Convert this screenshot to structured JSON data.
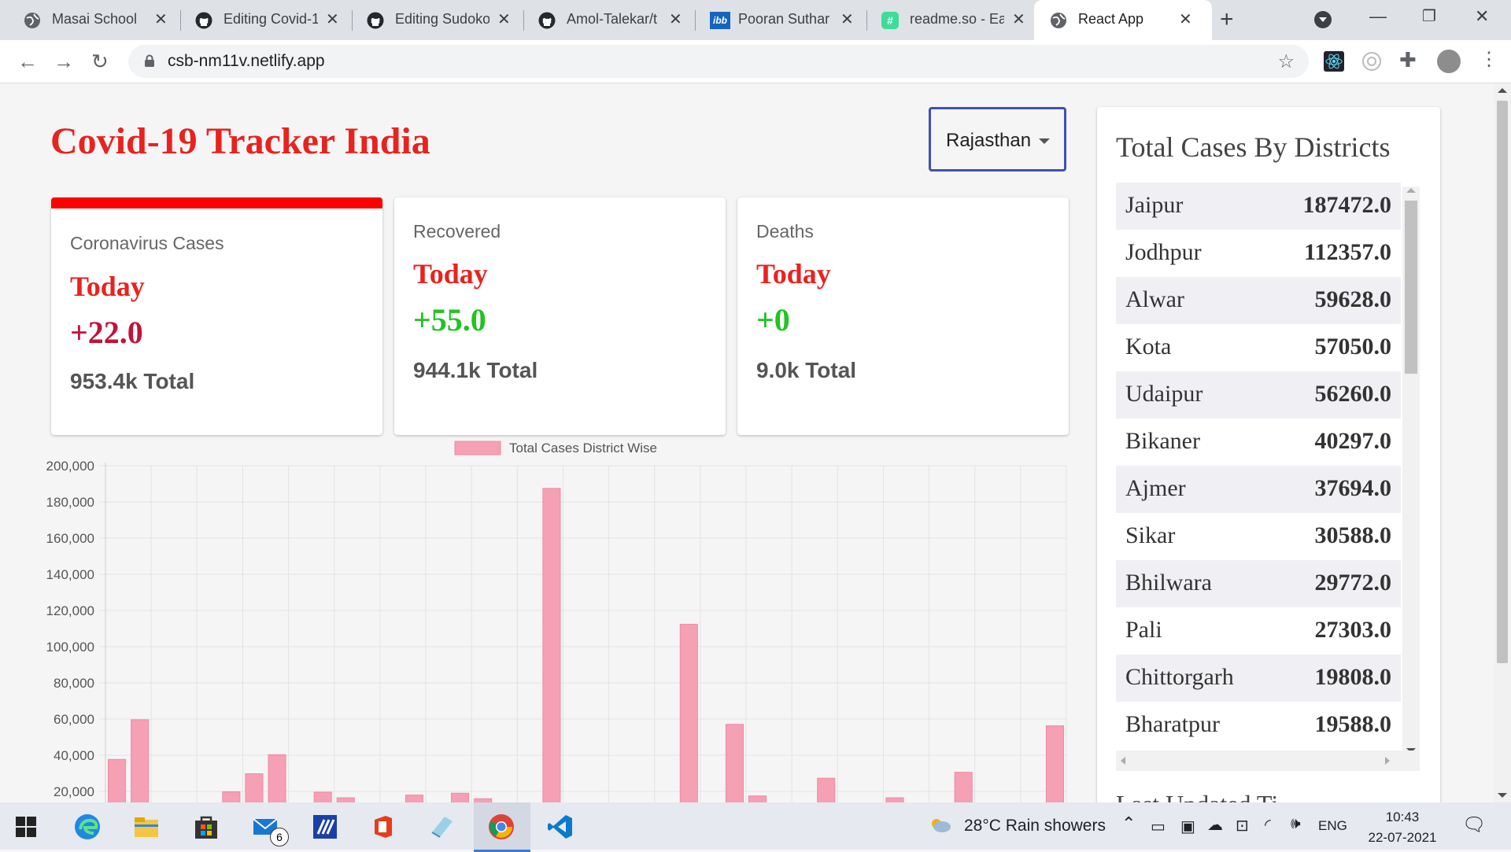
{
  "browser": {
    "tabs": [
      {
        "label": "Masai School",
        "icon": "globe-icon"
      },
      {
        "label": "Editing Covid-1",
        "icon": "github-icon"
      },
      {
        "label": "Editing Sudoko",
        "icon": "github-icon"
      },
      {
        "label": "Amol-Talekar/t",
        "icon": "github-icon"
      },
      {
        "label": "Pooran Suthar",
        "icon": "ibb-icon"
      },
      {
        "label": "readme.so - Ea",
        "icon": "readme-icon"
      },
      {
        "label": "React App",
        "icon": "globe-icon"
      }
    ],
    "url": "csb-nm11v.netlify.app"
  },
  "page": {
    "title": "Covid-19 Tracker India",
    "state_select": "Rajasthan",
    "cards": [
      {
        "title": "Coronavirus Cases",
        "today": "Today",
        "value": "+22.0",
        "total": "953.4k Total",
        "accent": "#c0143c"
      },
      {
        "title": "Recovered",
        "today": "Today",
        "value": "+55.0",
        "total": "944.1k Total",
        "accent": "#22c322"
      },
      {
        "title": "Deaths",
        "today": "Today",
        "value": "+0",
        "total": "9.0k Total",
        "accent": "#22c322"
      }
    ],
    "sidebar": {
      "title": "Total Cases By Districts",
      "districts": [
        {
          "name": "Jaipur",
          "value": "187472.0"
        },
        {
          "name": "Jodhpur",
          "value": "112357.0"
        },
        {
          "name": "Alwar",
          "value": "59628.0"
        },
        {
          "name": "Kota",
          "value": "57050.0"
        },
        {
          "name": "Udaipur",
          "value": "56260.0"
        },
        {
          "name": "Bikaner",
          "value": "40297.0"
        },
        {
          "name": "Ajmer",
          "value": "37694.0"
        },
        {
          "name": "Sikar",
          "value": "30588.0"
        },
        {
          "name": "Bhilwara",
          "value": "29772.0"
        },
        {
          "name": "Pali",
          "value": "27303.0"
        },
        {
          "name": "Chittorgarh",
          "value": "19808.0"
        },
        {
          "name": "Bharatpur",
          "value": "19588.0"
        }
      ],
      "footer": "Last Updated Ti"
    }
  },
  "chart_data": {
    "type": "bar",
    "legend": "Total Cases District Wise",
    "legend_position": "top",
    "color": "#f5a0b4",
    "ylim": [
      0,
      200000
    ],
    "yticks": [
      "20,000",
      "40,000",
      "60,000",
      "80,000",
      "100,000",
      "120,000",
      "140,000",
      "160,000",
      "180,000",
      "200,000"
    ],
    "values": [
      37694,
      59628,
      0,
      0,
      0,
      19808,
      29772,
      40297,
      0,
      19588,
      16500,
      0,
      0,
      18000,
      0,
      19000,
      16000,
      0,
      0,
      187472,
      0,
      0,
      0,
      0,
      0,
      112357,
      0,
      57050,
      17500,
      0,
      0,
      27303,
      0,
      0,
      16500,
      0,
      0,
      30588,
      0,
      0,
      0,
      56260
    ],
    "grid": true
  },
  "taskbar": {
    "weather": "28°C  Rain showers",
    "lang": "ENG",
    "time": "10:43",
    "date": "22-07-2021",
    "mail_badge": "6"
  }
}
